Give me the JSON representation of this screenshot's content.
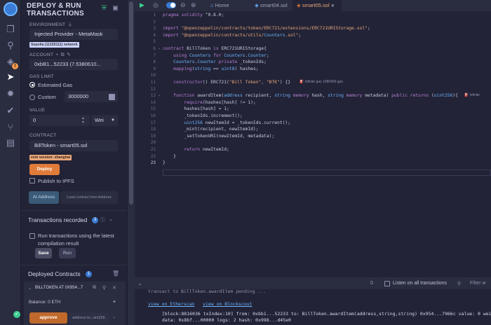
{
  "panel": {
    "title_line1": "DEPLOY & RUN",
    "title_line2": "TRANSACTIONS",
    "environment_label": "ENVIRONMENT",
    "environment_value": "Injected Provider - MetaMask",
    "network_tag": "Sepolia (11155111) network",
    "account_label": "ACCOUNT",
    "account_value": "0xbB1...52233 (7.5380610...",
    "gas_limit_label": "GAS LIMIT",
    "gas_estimated": "Estimated Gas",
    "gas_custom": "Custom",
    "gas_custom_value": "3000000",
    "value_label": "VALUE",
    "value_amount": "0",
    "value_unit": "Wei",
    "contract_label": "CONTRACT",
    "contract_value": "BillToken - smart05.sol",
    "evm_tag": "evm version: shanghai",
    "deploy_label": "Deploy",
    "publish_label": "Publish to IPFS",
    "at_address_label": "At Address",
    "load_contract_label": "Load contract from Address",
    "transactions_recorded": "Transactions recorded",
    "transactions_count": "3",
    "run_latest_line1": "Run transactions using the latest",
    "run_latest_line2": "compilation result",
    "save_label": "Save",
    "run_label": "Run",
    "deployed_contracts": "Deployed Contracts",
    "deployed_count": "1",
    "instance_label": "BILLTOKEN AT 0X954...7",
    "balance": "Balance: 0 ETH",
    "approve_label": "approve",
    "approve_placeholder": "address to, uint256"
  },
  "tabs": {
    "home": "Home",
    "smart04": "smart04.sol",
    "smart05": "smart05.sol"
  },
  "code_lines": [
    "pragma solidity ^0.8.0;",
    "",
    "import \"@openzeppelin/contracts/token/ERC721/extensions/ERC721URIStorage.sol\";",
    "import \"@openzeppelin/contracts/utils/Counters.sol\";",
    "",
    "contract BillToken is ERC721URIStorage{",
    "    using Counters for Counters.Counter;",
    "    Counters.Counter private _tokenIds;",
    "    mapping(string => uint8) hashes;",
    "",
    "    constructor() ERC721(\"Bill Token\", \"BTK\") {}",
    "",
    "    function awardItem(address recipient, string memory hash, string memory metadata) public returns (uint256){",
    "        require(hashes[hash] != 1);",
    "        hashes[hash] = 1;",
    "        _tokenIds.increment();",
    "        uint256 newItemId = _tokenIds.current();",
    "        _mint(recipient, newItemId);",
    "        _setTokenURI(newItemId, metadata);",
    "",
    "        return newItemId;",
    "    }",
    "}"
  ],
  "gas_hints": {
    "constructor": "infinite gas 1080400 gas",
    "award": "infinite"
  },
  "terminal": {
    "count": "0",
    "listen_label": "Listen on all transactions",
    "filter_placeholder": "Filter w",
    "pending_line": "transact to BillToken.awardItem pending ...",
    "etherscan": "view on Etherscan",
    "blockscout": "view on Blockscout",
    "log_line1": "[block:8816036 txIndex:10] from: 0xbb1...52233 to: BillToken.awardItem(address,string,string) 0x954...7966c value: 0 wei",
    "log_line2": "data: 0x8bf...00000 logs: 2 hash: 0x998...d45e0"
  }
}
